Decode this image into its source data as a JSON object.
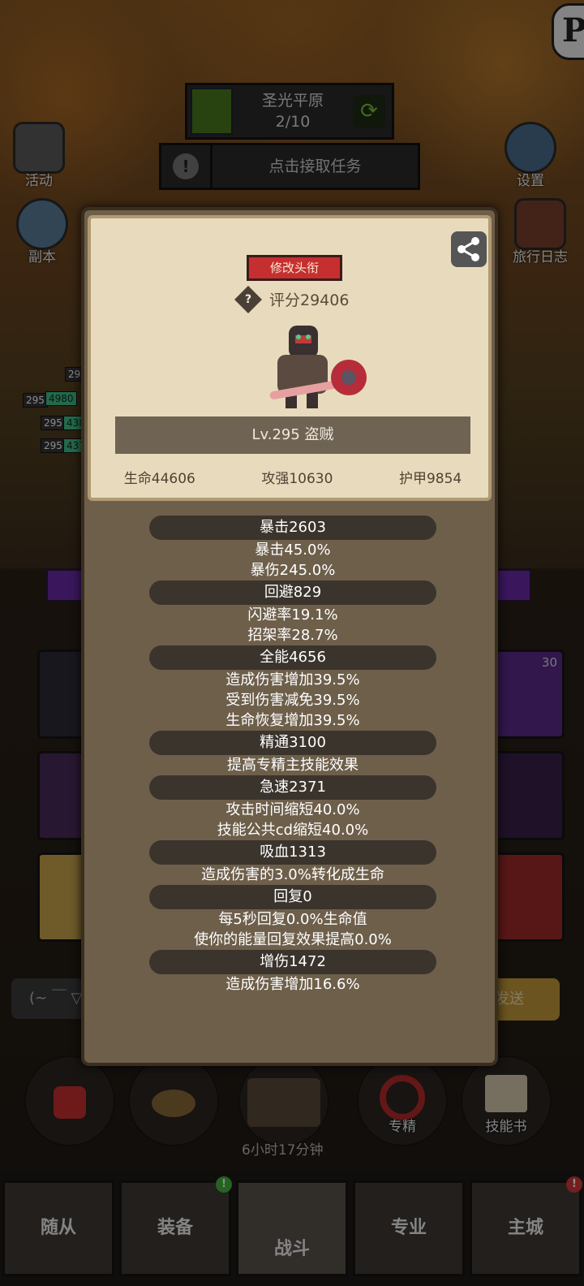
{
  "hud": {
    "corner_logo": "P",
    "location_name": "圣光平原",
    "location_progress": "2/10",
    "quest_prompt": "点击接取任务",
    "side_buttons": [
      {
        "label": "活动",
        "icon": "scroll-icon"
      },
      {
        "label": "副本",
        "icon": "portal-icon"
      },
      {
        "label": "设置",
        "icon": "gear-icon"
      },
      {
        "label": "旅行日志",
        "icon": "book-icon"
      }
    ],
    "unit_tags": [
      "295",
      "295",
      "295",
      "295",
      "295"
    ],
    "unit_green_tags": [
      "4980",
      "4380",
      "4378"
    ],
    "slot_count": "30",
    "chat_emote": "(~ ￣ ▽",
    "send_label": "发送",
    "timer": "6小时17分钟",
    "round_buttons": [
      {
        "label": "",
        "icon": "potion-icon"
      },
      {
        "label": "",
        "icon": "bread-icon"
      },
      {
        "label": "",
        "icon": "chest-icon"
      },
      {
        "label": "专精",
        "icon": "specialty-icon"
      },
      {
        "label": "技能书",
        "icon": "skillbook-icon"
      }
    ],
    "nav_tabs": [
      {
        "label": "随从",
        "badge": ""
      },
      {
        "label": "装备",
        "badge": "!"
      },
      {
        "label": "战斗",
        "badge": ""
      },
      {
        "label": "专业",
        "badge": ""
      },
      {
        "label": "主城",
        "badge": "!"
      }
    ],
    "colors": {
      "badge_green": "#46b23c",
      "badge_red": "#d23a3a"
    }
  },
  "profile": {
    "edit_title_label": "修改头衔",
    "score_label": "评分29406",
    "level_line": "Lv.295 盗贼",
    "base_stats": [
      "生命44606",
      "攻强10630",
      "护甲9854"
    ]
  },
  "stats": [
    {
      "head": "暴击2603",
      "lines": [
        "暴击45.0%",
        "暴伤245.0%"
      ]
    },
    {
      "head": "回避829",
      "lines": [
        "闪避率19.1%",
        "招架率28.7%"
      ]
    },
    {
      "head": "全能4656",
      "lines": [
        "造成伤害增加39.5%",
        "受到伤害减免39.5%",
        "生命恢复增加39.5%"
      ]
    },
    {
      "head": "精通3100",
      "lines": [
        "提高专精主技能效果"
      ]
    },
    {
      "head": "急速2371",
      "lines": [
        "攻击时间缩短40.0%",
        "技能公共cd缩短40.0%"
      ]
    },
    {
      "head": "吸血1313",
      "lines": [
        "造成伤害的3.0%转化成生命"
      ]
    },
    {
      "head": "回复0",
      "lines": [
        "每5秒回复0.0%生命值",
        "使你的能量回复效果提高0.0%"
      ]
    },
    {
      "head": "增伤1472",
      "lines": [
        "造成伤害增加16.6%"
      ]
    }
  ]
}
